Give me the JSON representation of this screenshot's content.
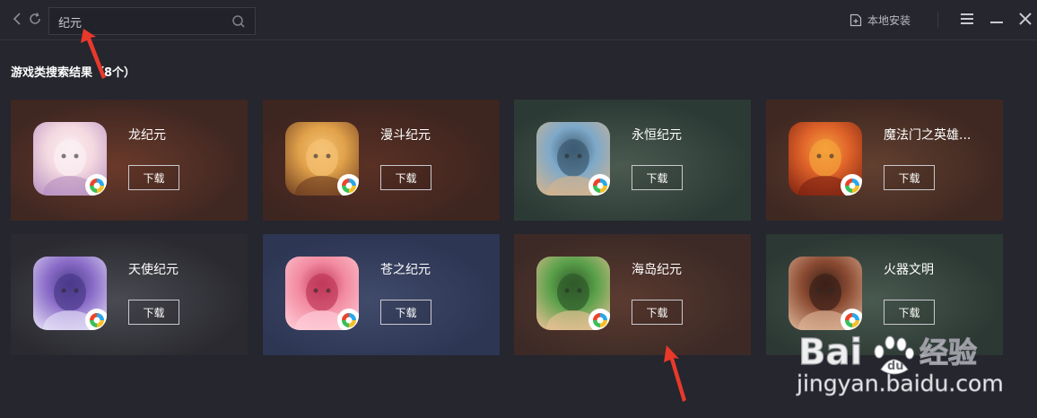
{
  "search": {
    "value": "纪元"
  },
  "toolbar": {
    "local_install_label": "本地安装"
  },
  "results": {
    "heading": "游戏类搜索结果（8个）"
  },
  "games": [
    {
      "name": "龙纪元",
      "download_label": "下载",
      "bg": "#3f2722",
      "glow": "#6a3a2a"
    },
    {
      "name": "漫斗纪元",
      "download_label": "下载",
      "bg": "#3d2520",
      "glow": "#5a3024"
    },
    {
      "name": "永恒纪元",
      "download_label": "下载",
      "bg": "#2c3a35",
      "glow": "#4a5a50"
    },
    {
      "name": "魔法门之英雄...",
      "download_label": "下载",
      "bg": "#3f2822",
      "glow": "#62402f"
    },
    {
      "name": "天使纪元",
      "download_label": "下载",
      "bg": "#2a2a30",
      "glow": "#4a4a52"
    },
    {
      "name": "苍之纪元",
      "download_label": "下载",
      "bg": "#2d3653",
      "glow": "#404a6a"
    },
    {
      "name": "海岛纪元",
      "download_label": "下载",
      "bg": "#3d2a26",
      "glow": "#5b3b30"
    },
    {
      "name": "火器文明",
      "download_label": "下载",
      "bg": "#2c3833",
      "glow": "#495a50"
    }
  ],
  "watermark": {
    "brand": "Bai",
    "brand_tail": "经验",
    "url": "jingyan.baidu.com"
  },
  "colors": {
    "background": "#25262e",
    "accent_arrow": "#e8392b"
  }
}
